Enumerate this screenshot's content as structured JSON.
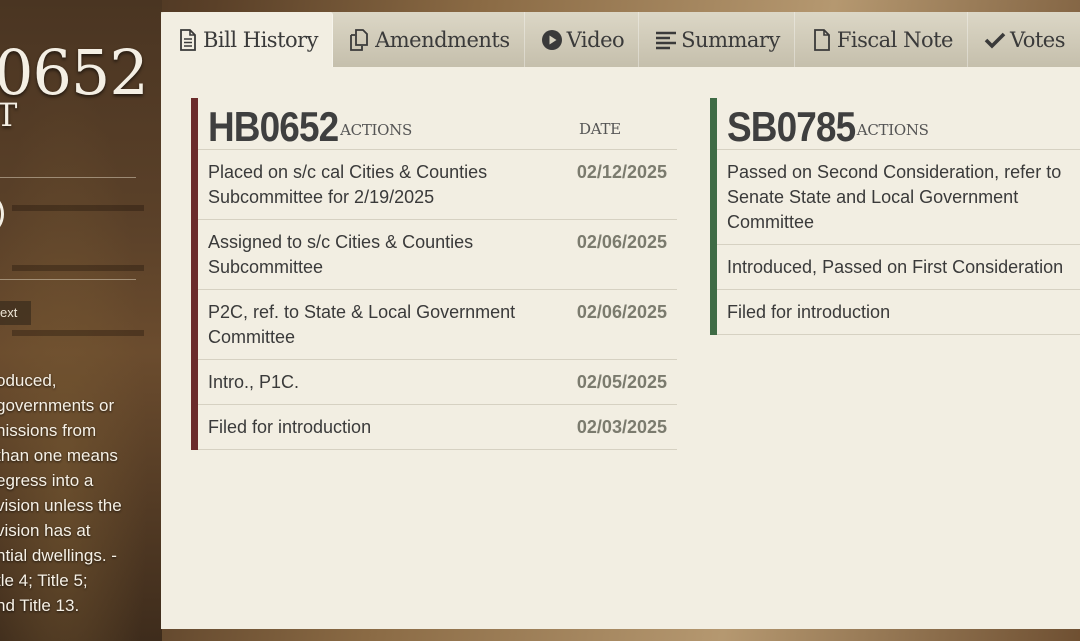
{
  "left": {
    "bill_number_fragment": "0652",
    "bill_sub_fragment": "T",
    "circle_fragment": "",
    "text_button": "ext",
    "description_lines": "oduced,\ngovernments or\nnissions from\nthan one means\negress into a\nvision unless the\nvision has at\nntial dwellings. -\ntle 4; Title 5;\nnd Title 13."
  },
  "tabs": [
    {
      "label": "Bill History",
      "icon": "document-icon"
    },
    {
      "label": "Amendments",
      "icon": "copy-icon"
    },
    {
      "label": "Video",
      "icon": "play-icon"
    },
    {
      "label": "Summary",
      "icon": "align-left-icon"
    },
    {
      "label": "Fiscal Note",
      "icon": "file-icon"
    },
    {
      "label": "Votes",
      "icon": "check-icon"
    }
  ],
  "house": {
    "bill": "HB0652",
    "actions_label": "ACTIONS",
    "date_label": "DATE",
    "rows": [
      {
        "action": "Placed on s/c cal Cities & Counties Subcommittee for 2/19/2025",
        "date": "02/12/2025"
      },
      {
        "action": "Assigned to s/c Cities & Counties Subcommittee",
        "date": "02/06/2025"
      },
      {
        "action": "P2C, ref. to State & Local Government Committee",
        "date": "02/06/2025"
      },
      {
        "action": "Intro., P1C.",
        "date": "02/05/2025"
      },
      {
        "action": "Filed for introduction",
        "date": "02/03/2025"
      }
    ]
  },
  "senate": {
    "bill": "SB0785",
    "actions_label": "ACTIONS",
    "rows": [
      {
        "action": "Passed on Second Consideration, refer to Senate State and Local Government Committee"
      },
      {
        "action": "Introduced, Passed on First Consideration"
      },
      {
        "action": "Filed for introduction"
      }
    ]
  },
  "colors": {
    "house_accent": "#6b2b2b",
    "senate_accent": "#3f6b45",
    "panel_bg": "#f2eee2"
  }
}
